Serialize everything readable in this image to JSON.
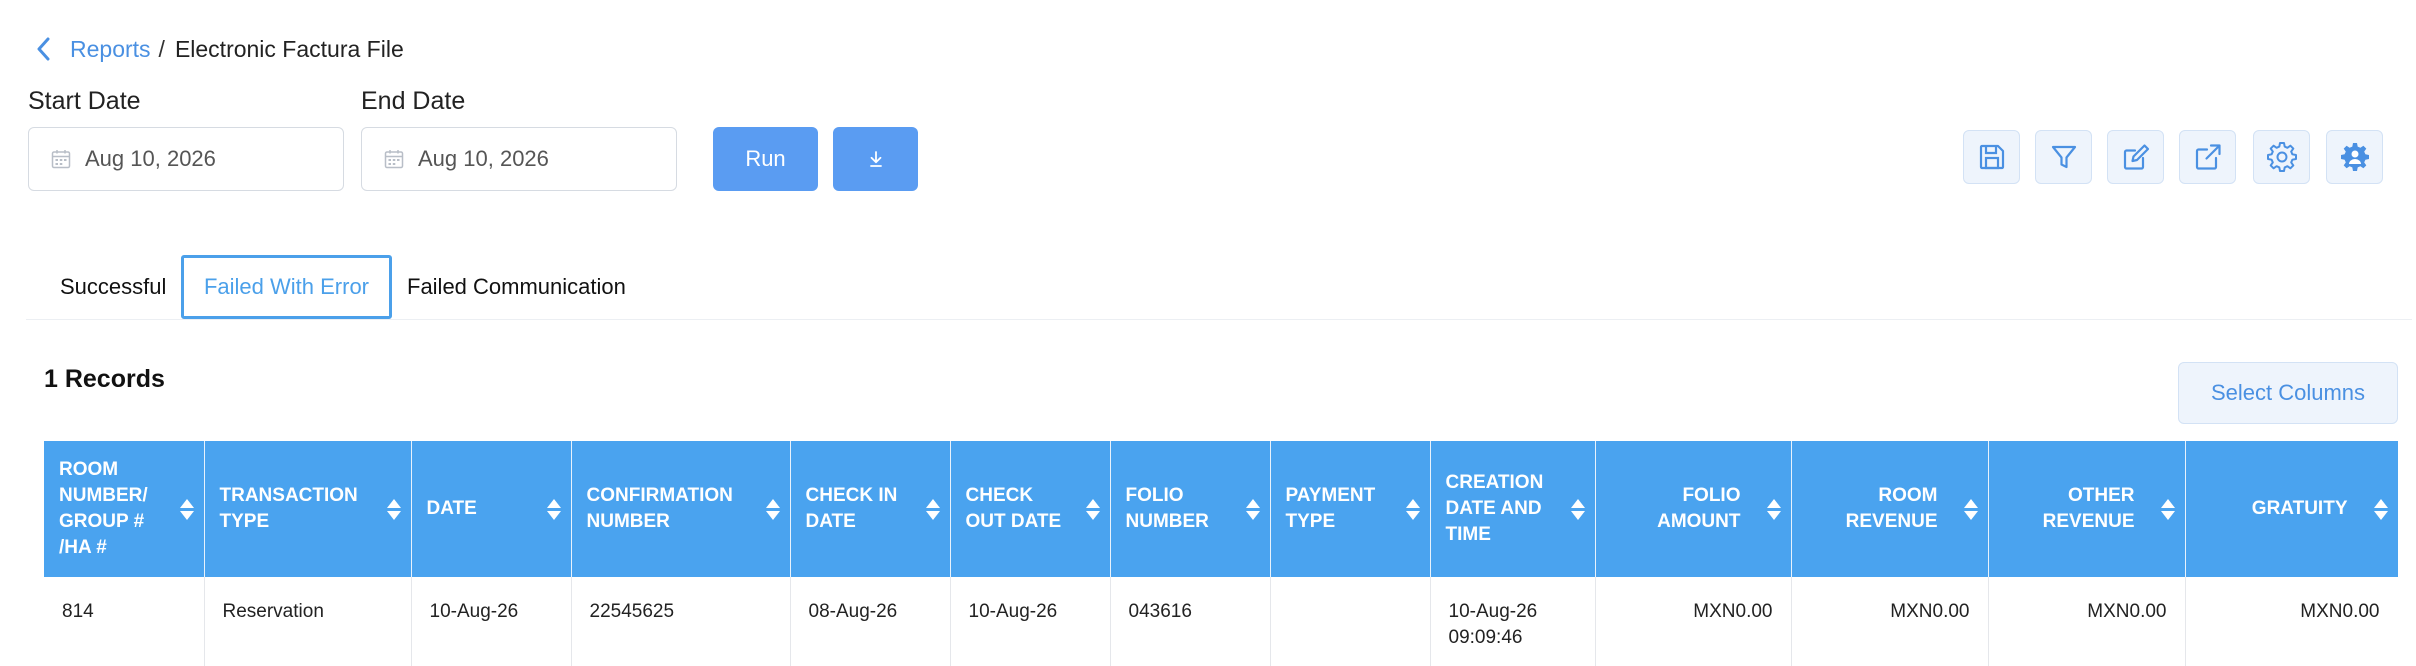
{
  "breadcrumb": {
    "parent": "Reports",
    "separator": "/",
    "current": "Electronic Factura File"
  },
  "filters": {
    "start_label": "Start Date",
    "start_value": "Aug 10, 2026",
    "end_label": "End Date",
    "end_value": "Aug 10, 2026",
    "run_label": "Run"
  },
  "toolbar_icons": [
    "save-icon",
    "filter-icon",
    "edit-icon",
    "export-icon",
    "settings-icon",
    "advanced-settings-icon"
  ],
  "tabs": [
    {
      "label": "Successful"
    },
    {
      "label": "Failed With Error"
    },
    {
      "label": "Failed Communication"
    }
  ],
  "records_label": "1 Records",
  "select_columns_label": "Select Columns",
  "table": {
    "headers": [
      "ROOM NUMBER/ GROUP # /HA #",
      "TRANSACTION TYPE",
      "DATE",
      "CONFIRMATION NUMBER",
      "CHECK IN DATE",
      "CHECK OUT DATE",
      "FOLIO NUMBER",
      "PAYMENT TYPE",
      "CREATION DATE AND TIME",
      "FOLIO AMOUNT",
      "ROOM REVENUE",
      "OTHER REVENUE",
      "GRATUITY"
    ],
    "rows": [
      [
        "814",
        "Reservation",
        "10-Aug-26",
        "22545625",
        "08-Aug-26",
        "10-Aug-26",
        "043616",
        "",
        "10-Aug-26 09:09:46",
        "MXN0.00",
        "MXN0.00",
        "MXN0.00",
        "MXN0.00"
      ]
    ]
  },
  "colors": {
    "accent": "#4aa3ef",
    "link": "#4a90e2",
    "button": "#5a9cf2",
    "tool_bg": "#eef4fc"
  }
}
